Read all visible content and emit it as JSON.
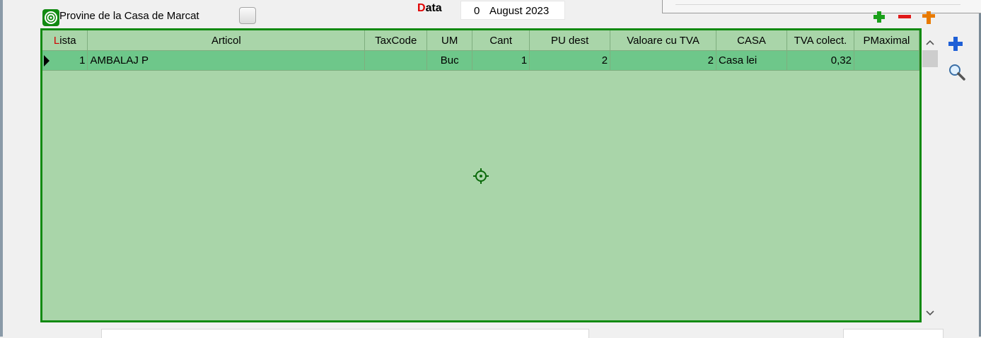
{
  "header": {
    "flag_label": "Provine de la Casa de Marcat",
    "date_label_first": "D",
    "date_label_rest": "ata",
    "date_day": "0",
    "date_month_year": "August 2023"
  },
  "grid": {
    "columns": [
      {
        "first": "L",
        "rest": "ista"
      },
      {
        "label": "Articol"
      },
      {
        "label": "TaxCode"
      },
      {
        "label": "UM"
      },
      {
        "label": "Cant"
      },
      {
        "label": "PU dest"
      },
      {
        "label": "Valoare cu TVA"
      },
      {
        "label": "CASA"
      },
      {
        "label": "TVA colect."
      },
      {
        "label": "PMaximal"
      }
    ],
    "rows": [
      {
        "lista": "1",
        "articol": "AMBALAJ P",
        "taxcode": "",
        "um": "Buc",
        "cant": "1",
        "pu_dest": "2",
        "valoare_cu_tva": "2",
        "casa": "Casa lei",
        "tva_colect": "0,32",
        "pmaximal": ""
      }
    ]
  },
  "icons": {
    "add": "plus-icon",
    "remove": "minus-icon",
    "insert": "orange-plus-icon",
    "search": "magnifier-icon",
    "target": "crosshair-icon",
    "scroll_up": "chevron-up-icon",
    "scroll_down": "chevron-down-icon"
  },
  "colors": {
    "grid_border": "#128a12",
    "grid_bg": "#a9d5a9",
    "selected_row": "#6ec78a",
    "accent_red": "#e00000"
  }
}
